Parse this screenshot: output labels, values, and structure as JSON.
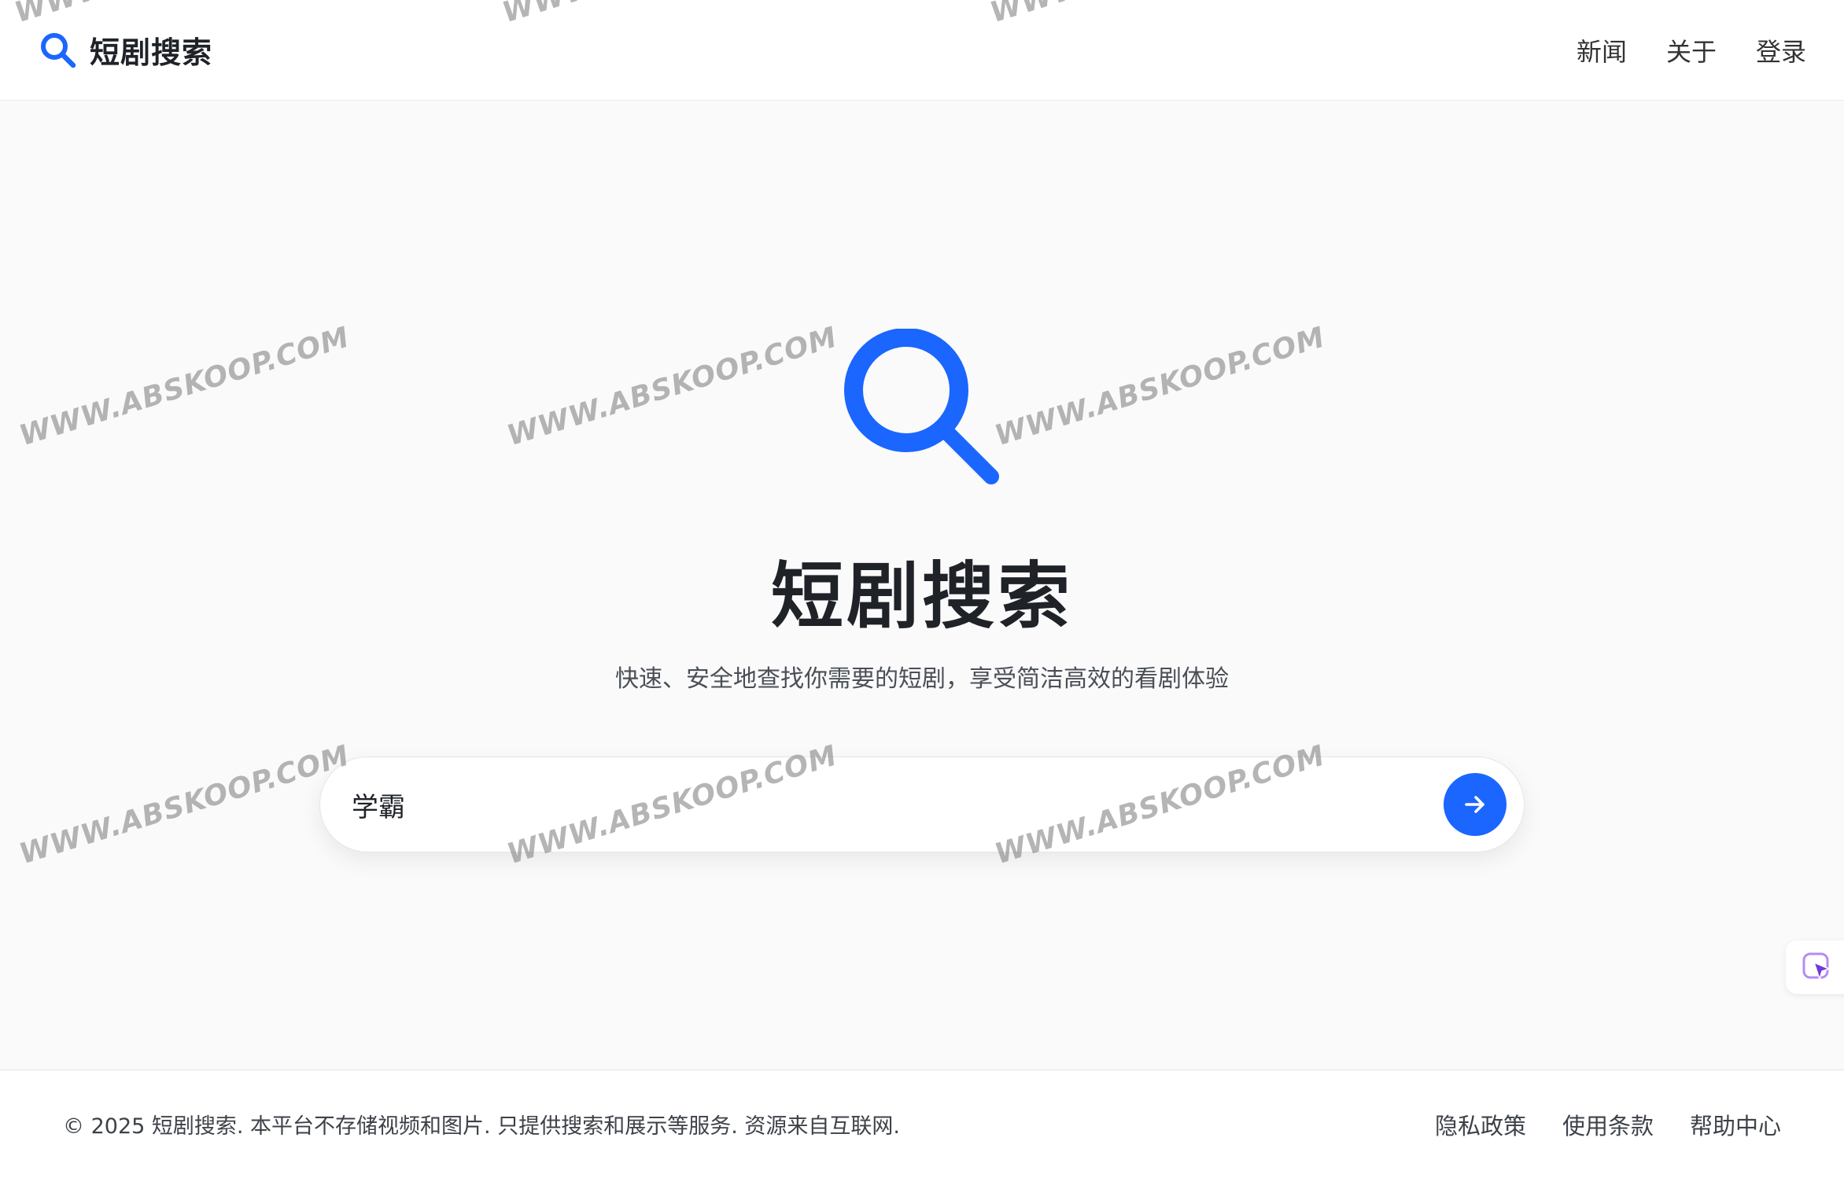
{
  "brand": {
    "name": "短剧搜索",
    "accent_color": "#1a66ff",
    "icon": "search-icon"
  },
  "nav": {
    "items": [
      {
        "label": "新闻"
      },
      {
        "label": "关于"
      },
      {
        "label": "登录"
      }
    ]
  },
  "hero": {
    "icon": "search-icon",
    "title": "短剧搜索",
    "subtitle": "快速、安全地查找你需要的短剧，享受简洁高效的看剧体验"
  },
  "search": {
    "value": "学霸",
    "submit_icon": "arrow-right-icon"
  },
  "watermark": {
    "text": "WWW.ABSKOOP.COM"
  },
  "side_widget": {
    "icon": "pointer-select-icon"
  },
  "footer": {
    "copyright": "© 2025 短剧搜索. 本平台不存储视频和图片. 只提供搜索和展示等服务. 资源来自互联网.",
    "links": [
      {
        "label": "隐私政策"
      },
      {
        "label": "使用条款"
      },
      {
        "label": "帮助中心"
      }
    ]
  }
}
